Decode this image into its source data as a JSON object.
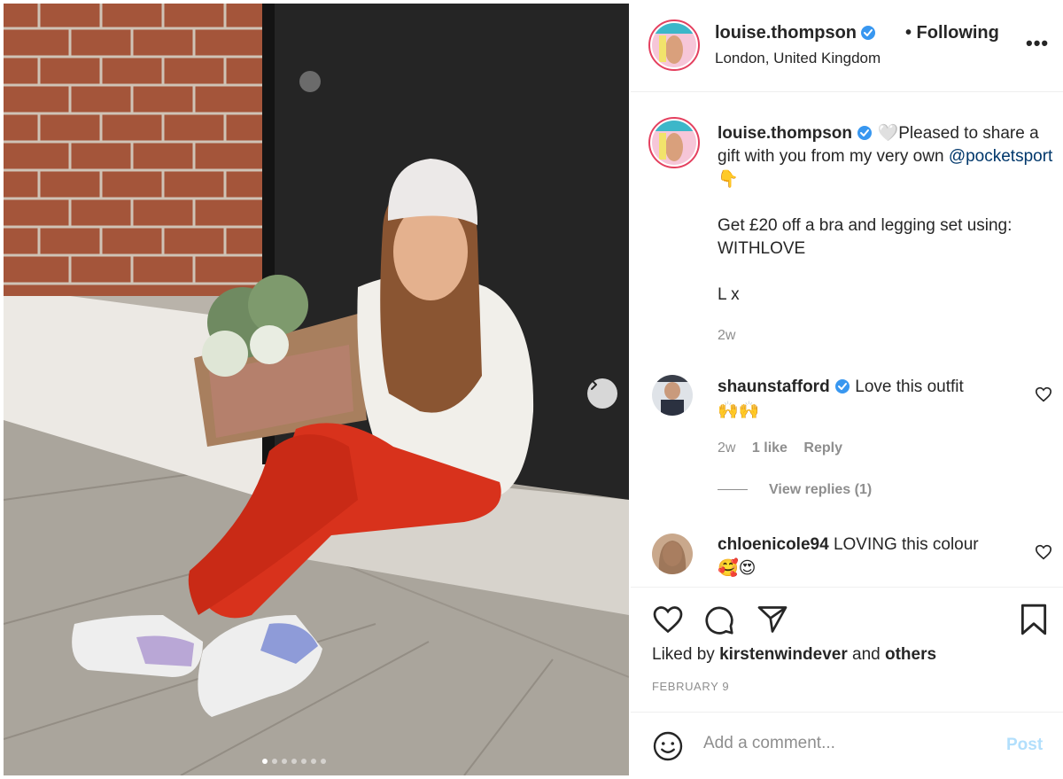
{
  "post": {
    "next_label": "Next",
    "slide_count": 7,
    "active_slide": 1
  },
  "header": {
    "username": "louise.thompson",
    "following": "• Following",
    "location": "London, United Kingdom",
    "more": "•••"
  },
  "caption": {
    "username": "louise.thompson",
    "heart_emoji": "🤍",
    "text_1": "Pleased to share a gift with you from my very own",
    "mention": "@pocketsport",
    "point_emoji": "👇",
    "text_2": "Get £20 off a bra and legging set using: WITHLOVE",
    "text_3": "L x",
    "time": "2w"
  },
  "comments": [
    {
      "username": "shaunstafford",
      "verified": true,
      "text": "Love this outfit",
      "emoji": "🙌🙌",
      "time": "2w",
      "likes": "1 like",
      "reply": "Reply",
      "view_replies": "View replies (1)"
    },
    {
      "username": "chloenicole94",
      "verified": false,
      "text": "LOVING this colour",
      "emoji": "🥰😍"
    }
  ],
  "actions": {
    "like_icon": "heart-icon",
    "comment_icon": "comment-icon",
    "share_icon": "paper-plane-icon",
    "save_icon": "bookmark-icon"
  },
  "likes": {
    "prefix": "Liked by",
    "user": "kirstenwindever",
    "connector": "and",
    "others": "others"
  },
  "date": "FEBRUARY 9",
  "comment_form": {
    "emoji_icon": "smiley-icon",
    "placeholder": "Add a comment...",
    "post_label": "Post"
  },
  "colors": {
    "verified": "#3897f0",
    "link": "#00376b",
    "post_disabled": "#b2dffc",
    "secondary_text": "#8e8e8e"
  }
}
